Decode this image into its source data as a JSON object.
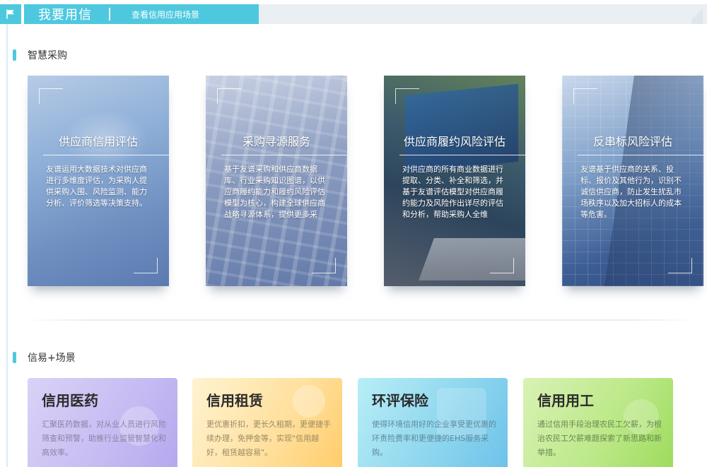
{
  "header": {
    "title": "我要用信",
    "link": "查看信用应用场景"
  },
  "sections": {
    "smart_procurement": "智慧采购",
    "scenes": "信易+场景"
  },
  "feature_cards": [
    {
      "title": "供应商信用评估",
      "desc": "友谱运用大数据技术对供应商进行多维度评估，为采购人提供采购入围、风险监测、能力分析、评价筛选等决策支持。"
    },
    {
      "title": "采购寻源服务",
      "desc": "基于友谱采购和供应商数据库、行业采购知识图谱，以供应商履约能力和履约风险评估模型为核心，构建全球供应商战略寻源体系，提供更多采"
    },
    {
      "title": "供应商履约风险评估",
      "desc": "对供应商的所有商业数据进行提取、分类、补全和筛选，并基于友谱评估模型对供应商履约能力及风险作出详尽的评估和分析，帮助采购人全维"
    },
    {
      "title": "反串标风险评估",
      "desc": "友谱基于供应商的关系、投标、报价及其他行为，识别不诚信供应商，防止发生扰乱市场秩序以及加大招标人的成本等危害。"
    }
  ],
  "scene_cards": [
    {
      "title": "信用医药",
      "desc": "汇聚医药数据，对从业人员进行风险筛查和预警，助推行业监管智慧化和高效率。"
    },
    {
      "title": "信用租赁",
      "desc": "更优惠折扣，更长久租期，更便捷手续办理，免押金等，实现\"信用越好，租赁越容易\"。"
    },
    {
      "title": "环评保险",
      "desc": "使得环境信用好的企业享受更优惠的环责险费率和更便捷的EHS服务采购。"
    },
    {
      "title": "信用用工",
      "desc": "通过信用手段治理农民工欠薪，为根治农民工欠薪难题探索了新思路和新举措。"
    }
  ],
  "colors": {
    "accent": "#4ec8de",
    "header_track": "#e9eff3"
  }
}
